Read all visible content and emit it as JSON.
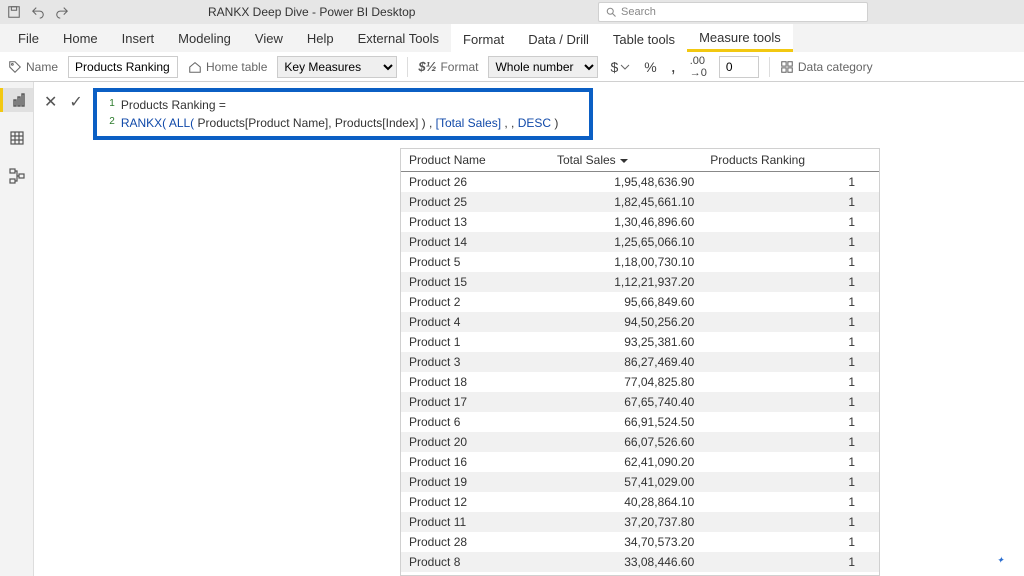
{
  "titlebar": {
    "title": "RANKX Deep Dive - Power BI Desktop",
    "search_placeholder": "Search"
  },
  "ribbon_tabs": [
    "File",
    "Home",
    "Insert",
    "Modeling",
    "View",
    "Help",
    "External Tools",
    "Format",
    "Data / Drill",
    "Table tools",
    "Measure tools"
  ],
  "active_tab_index": 10,
  "ribbon": {
    "name_label": "Name",
    "name_value": "Products Ranking",
    "home_table_label": "Home table",
    "home_table_value": "Key Measures",
    "format_label": "Format",
    "format_value": "Whole number",
    "currency": "$",
    "percent": "%",
    "comma": ",",
    "dec_inc": ".00",
    "decimals_value": "0",
    "data_category_label": "Data category"
  },
  "formula": {
    "line1": "Products Ranking =",
    "line2_parts": [
      "RANKX(",
      " ALL(",
      " Products[Product Name]",
      ", Products[Index] )",
      " , ",
      "[Total Sales]",
      " , , ",
      "DESC",
      " )"
    ]
  },
  "table": {
    "headers": [
      "Product Name",
      "Total Sales",
      "Products Ranking"
    ],
    "rows": [
      [
        "Product 26",
        "1,95,48,636.90",
        "1"
      ],
      [
        "Product 25",
        "1,82,45,661.10",
        "1"
      ],
      [
        "Product 13",
        "1,30,46,896.60",
        "1"
      ],
      [
        "Product 14",
        "1,25,65,066.10",
        "1"
      ],
      [
        "Product 5",
        "1,18,00,730.10",
        "1"
      ],
      [
        "Product 15",
        "1,12,21,937.20",
        "1"
      ],
      [
        "Product 2",
        "95,66,849.60",
        "1"
      ],
      [
        "Product 4",
        "94,50,256.20",
        "1"
      ],
      [
        "Product 1",
        "93,25,381.60",
        "1"
      ],
      [
        "Product 3",
        "86,27,469.40",
        "1"
      ],
      [
        "Product 18",
        "77,04,825.80",
        "1"
      ],
      [
        "Product 17",
        "67,65,740.40",
        "1"
      ],
      [
        "Product 6",
        "66,91,524.50",
        "1"
      ],
      [
        "Product 20",
        "66,07,526.60",
        "1"
      ],
      [
        "Product 16",
        "62,41,090.20",
        "1"
      ],
      [
        "Product 19",
        "57,41,029.00",
        "1"
      ],
      [
        "Product 12",
        "40,28,864.10",
        "1"
      ],
      [
        "Product 11",
        "37,20,737.80",
        "1"
      ],
      [
        "Product 28",
        "34,70,573.20",
        "1"
      ],
      [
        "Product 8",
        "33,08,446.60",
        "1"
      ]
    ]
  }
}
